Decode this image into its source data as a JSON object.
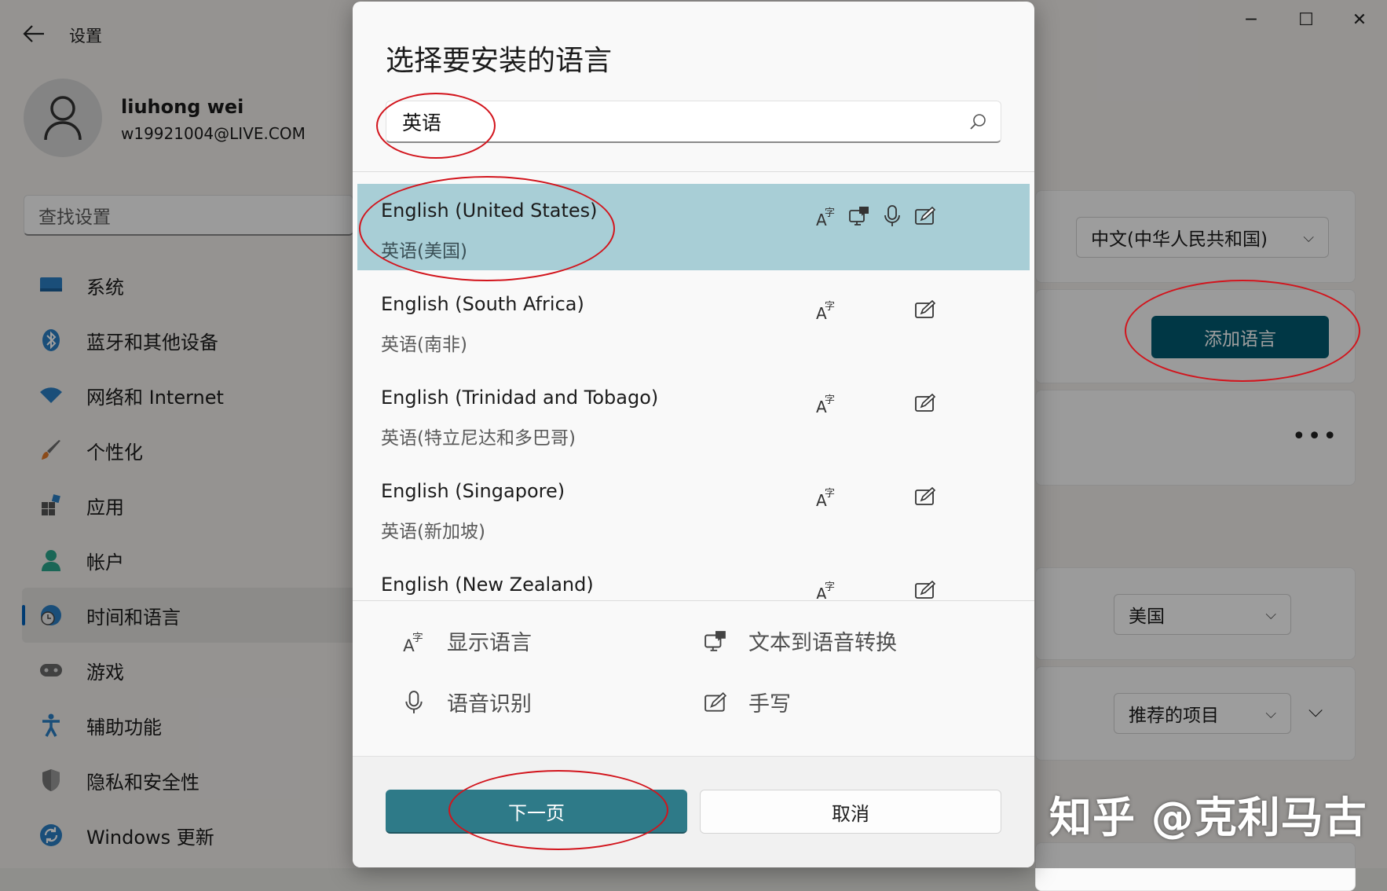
{
  "window": {
    "app_title": "设置",
    "controls": {
      "minimize": "─",
      "maximize": "☐",
      "close": "✕"
    }
  },
  "user": {
    "name": "liuhong wei",
    "email": "w19921004@LIVE.COM"
  },
  "settings_search": {
    "placeholder": "查找设置"
  },
  "sidebar": {
    "items": [
      {
        "label": "系统",
        "icon": "monitor-icon"
      },
      {
        "label": "蓝牙和其他设备",
        "icon": "bluetooth-icon"
      },
      {
        "label": "网络和 Internet",
        "icon": "wifi-icon"
      },
      {
        "label": "个性化",
        "icon": "brush-icon"
      },
      {
        "label": "应用",
        "icon": "apps-icon"
      },
      {
        "label": "帐户",
        "icon": "person-icon"
      },
      {
        "label": "时间和语言",
        "icon": "globe-clock-icon",
        "active": true
      },
      {
        "label": "游戏",
        "icon": "gamepad-icon"
      },
      {
        "label": "辅助功能",
        "icon": "accessibility-icon"
      },
      {
        "label": "隐私和安全性",
        "icon": "shield-icon"
      },
      {
        "label": "Windows 更新",
        "icon": "update-icon"
      }
    ]
  },
  "background": {
    "display_language": "中文(中华人民共和国)",
    "add_language": "添加语言",
    "more": "•••",
    "region": "美国",
    "format": "推荐的项目"
  },
  "dialog": {
    "title": "选择要安装的语言",
    "search_value": "英语",
    "languages": [
      {
        "name": "English (United States)",
        "local": "英语(美国)",
        "features": [
          "display",
          "tts",
          "speech",
          "handwriting"
        ],
        "selected": true
      },
      {
        "name": "English (South Africa)",
        "local": "英语(南非)",
        "features": [
          "display",
          "handwriting"
        ]
      },
      {
        "name": "English (Trinidad and Tobago)",
        "local": "英语(特立尼达和多巴哥)",
        "features": [
          "display",
          "handwriting"
        ]
      },
      {
        "name": "English (Singapore)",
        "local": "英语(新加坡)",
        "features": [
          "display",
          "handwriting"
        ]
      },
      {
        "name": "English (New Zealand)",
        "local": "",
        "features": [
          "display",
          "handwriting"
        ]
      }
    ],
    "legend": {
      "display": "显示语言",
      "tts": "文本到语音转换",
      "speech": "语音识别",
      "handwriting": "手写"
    },
    "next_button": "下一页",
    "cancel_button": "取消"
  },
  "watermark": "知乎 @克利马古",
  "colors": {
    "accent": "#005a70",
    "next_button": "#2e7a88",
    "selected_row": "#a8ced6",
    "annotation": "#d2141c"
  }
}
